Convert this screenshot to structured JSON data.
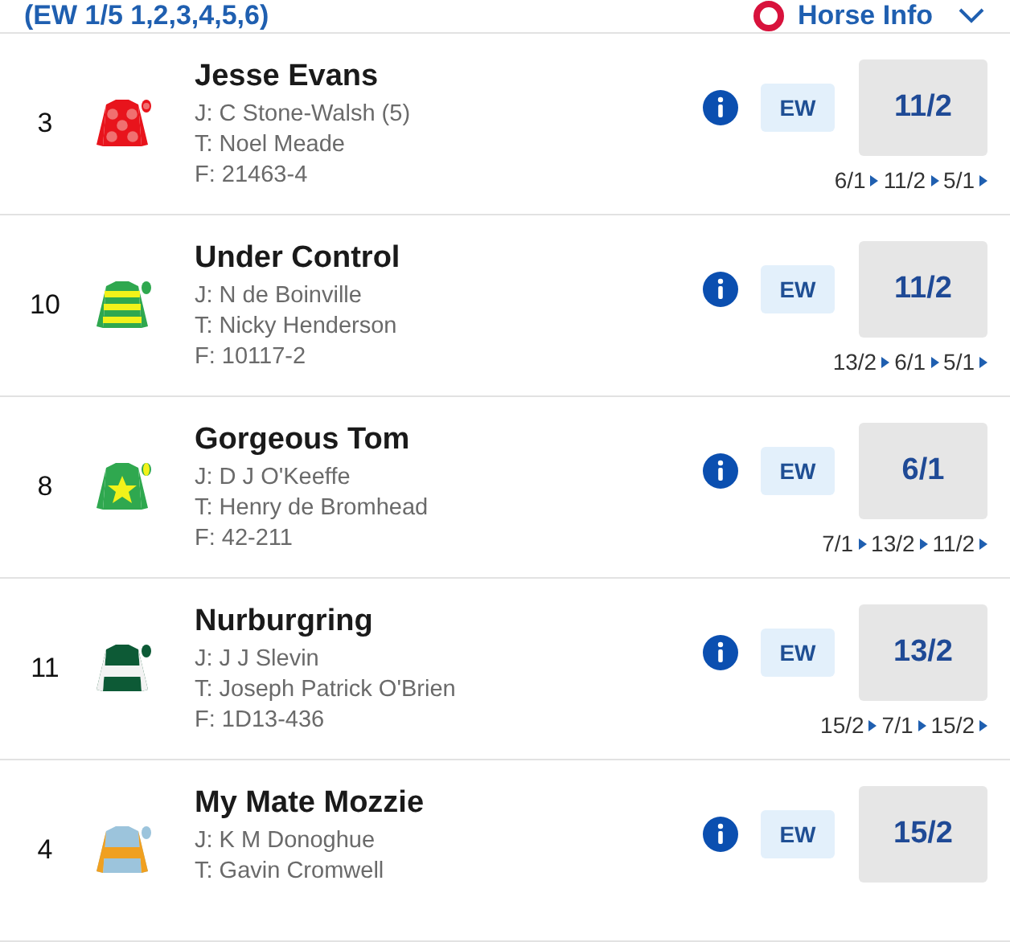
{
  "header": {
    "terms": "(EW 1/5 1,2,3,4,5,6)",
    "horse_info": "Horse Info"
  },
  "runners": [
    {
      "number": "3",
      "name": "Jesse Evans",
      "jockey": "J: C Stone-Walsh (5)",
      "trainer": "T: Noel Meade",
      "form": "F: 21463-4",
      "silk": [
        {
          "kind": "body",
          "color": "#e8141c"
        },
        {
          "kind": "spots",
          "color": "#f07070"
        }
      ],
      "ew": "EW",
      "odds": "11/2",
      "history": [
        "6/1",
        "11/2",
        "5/1"
      ]
    },
    {
      "number": "10",
      "name": "Under Control",
      "jockey": "J: N de Boinville",
      "trainer": "T: Nicky Henderson",
      "form": "F: 10117-2",
      "silk": [
        {
          "kind": "body",
          "color": "#2fa84f"
        },
        {
          "kind": "hoops",
          "color": "#f2f21a"
        }
      ],
      "ew": "EW",
      "odds": "11/2",
      "history": [
        "13/2",
        "6/1",
        "5/1"
      ]
    },
    {
      "number": "8",
      "name": "Gorgeous Tom",
      "jockey": "J: D J O'Keeffe",
      "trainer": "T: Henry de Bromhead",
      "form": "F: 42-211",
      "silk": [
        {
          "kind": "body",
          "color": "#2fa84f"
        },
        {
          "kind": "star",
          "color": "#f2f21a"
        }
      ],
      "ew": "EW",
      "odds": "6/1",
      "history": [
        "7/1",
        "13/2",
        "11/2"
      ]
    },
    {
      "number": "11",
      "name": "Nurburgring",
      "jockey": "J: J J Slevin",
      "trainer": "T: Joseph Patrick O'Brien",
      "form": "F: 1D13-436",
      "silk": [
        {
          "kind": "body",
          "color": "#0d5a36"
        },
        {
          "kind": "hoop",
          "color": "#f3f3f3"
        }
      ],
      "ew": "EW",
      "odds": "13/2",
      "history": [
        "15/2",
        "7/1",
        "15/2"
      ]
    },
    {
      "number": "4",
      "name": "My Mate Mozzie",
      "jockey": "J: K M Donoghue",
      "trainer": "T: Gavin Cromwell",
      "silk": [
        {
          "kind": "body",
          "color": "#9cc4dc"
        },
        {
          "kind": "hoop",
          "color": "#f0a020"
        }
      ],
      "ew": "EW",
      "odds": "15/2"
    }
  ]
}
